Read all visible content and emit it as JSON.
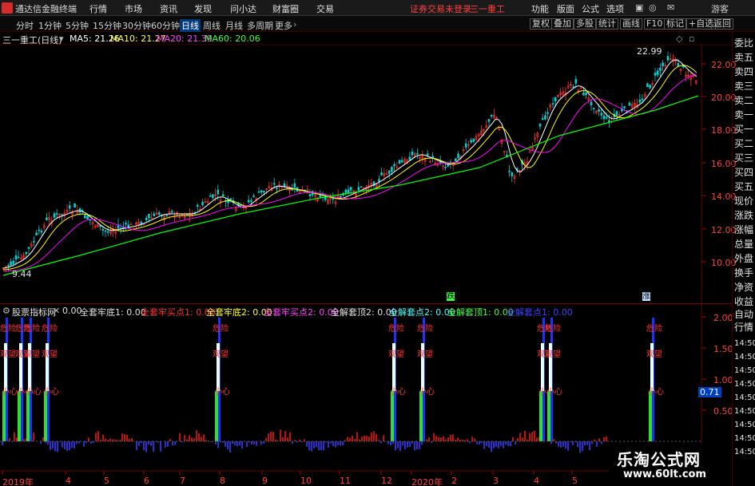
{
  "app": {
    "name": "通达信金融终端",
    "menu": [
      "行情",
      "市场",
      "资讯",
      "发现",
      "问小达",
      "财富圈",
      "交易"
    ],
    "login_notice": "证券交易未登录",
    "stock_title": "三一重工",
    "right_menu": [
      "功能",
      "版面",
      "公式",
      "选项"
    ],
    "guest": "游客"
  },
  "periods": [
    "分时",
    "1分钟",
    "5分钟",
    "15分钟",
    "30分钟",
    "60分钟",
    "日线",
    "周线",
    "月线",
    "多周期",
    "更多"
  ],
  "active_period": "日线",
  "tools": [
    "复权",
    "叠加",
    "多股",
    "统计",
    "画线",
    "F10",
    "标记",
    "+自选",
    "返回"
  ],
  "main_header": {
    "name": "三一重工(日线)",
    "ma5": "MA5: 21.26",
    "ma10": "MA10: 21.27",
    "ma20": "MA20: 21.39",
    "ma60": "MA60: 20.06"
  },
  "price_axis": [
    "22.00",
    "20.00",
    "18.00",
    "16.00",
    "14.00",
    "12.00",
    "10.00"
  ],
  "annotations": {
    "high": "22.99",
    "low": "9.44"
  },
  "markers": {
    "die": "跌",
    "zhang": "涨"
  },
  "right_tabs": [
    "委比",
    "卖五",
    "卖四",
    "卖三",
    "卖二",
    "卖一",
    "买一",
    "买二",
    "买三",
    "买四",
    "买五",
    "现价",
    "涨跌",
    "涨幅",
    "总量",
    "外盘",
    "换手",
    "净资",
    "收益",
    "自动",
    "行情"
  ],
  "right_times": [
    "14:50",
    "14:50",
    "14:50",
    "14:50",
    "14:50",
    "14:50",
    "14:50",
    "14:50",
    "14:50"
  ],
  "sub_header": {
    "name": "股票指标网",
    "items": [
      {
        "t": "0.00",
        "c": "#e0e0e0"
      },
      {
        "t": "全套牢底1: 0.00",
        "c": "#e0e0e0"
      },
      {
        "t": "全套牢买点1: 0.00",
        "c": "#ff3030"
      },
      {
        "t": "全套牢底2: 0.00",
        "c": "#ffff40"
      },
      {
        "t": "全套牢买点2: 0.00",
        "c": "#ff40ff"
      },
      {
        "t": "全解套顶2: 0.00",
        "c": "#e0e0e0"
      },
      {
        "t": "全解套点2: 0.00",
        "c": "#40ffff"
      },
      {
        "t": "全解套顶1: 0.00",
        "c": "#40ff40"
      },
      {
        "t": "全解套点1: 0.00",
        "c": "#4040ff"
      }
    ]
  },
  "sub_axis": [
    "2.00",
    "1.50",
    "1.00",
    "0.50"
  ],
  "sub_value": "0.71",
  "sub_labels": {
    "danger": "危险",
    "watch": "观望",
    "careful": "小心"
  },
  "x_labels": [
    "2019年",
    "4",
    "5",
    "6",
    "7",
    "8",
    "9",
    "10",
    "11",
    "12",
    "2020年",
    "2",
    "3",
    "4",
    "5"
  ],
  "watermark": {
    "title": "乐淘公式网",
    "url": "www.60lt.com"
  },
  "colors": {
    "up": "#ff3030",
    "down": "#00d0d0",
    "ma5": "#ffffff",
    "ma10": "#ffff00",
    "ma20": "#ff00ff",
    "ma60": "#00ff00",
    "axis": "#ff4040"
  }
}
